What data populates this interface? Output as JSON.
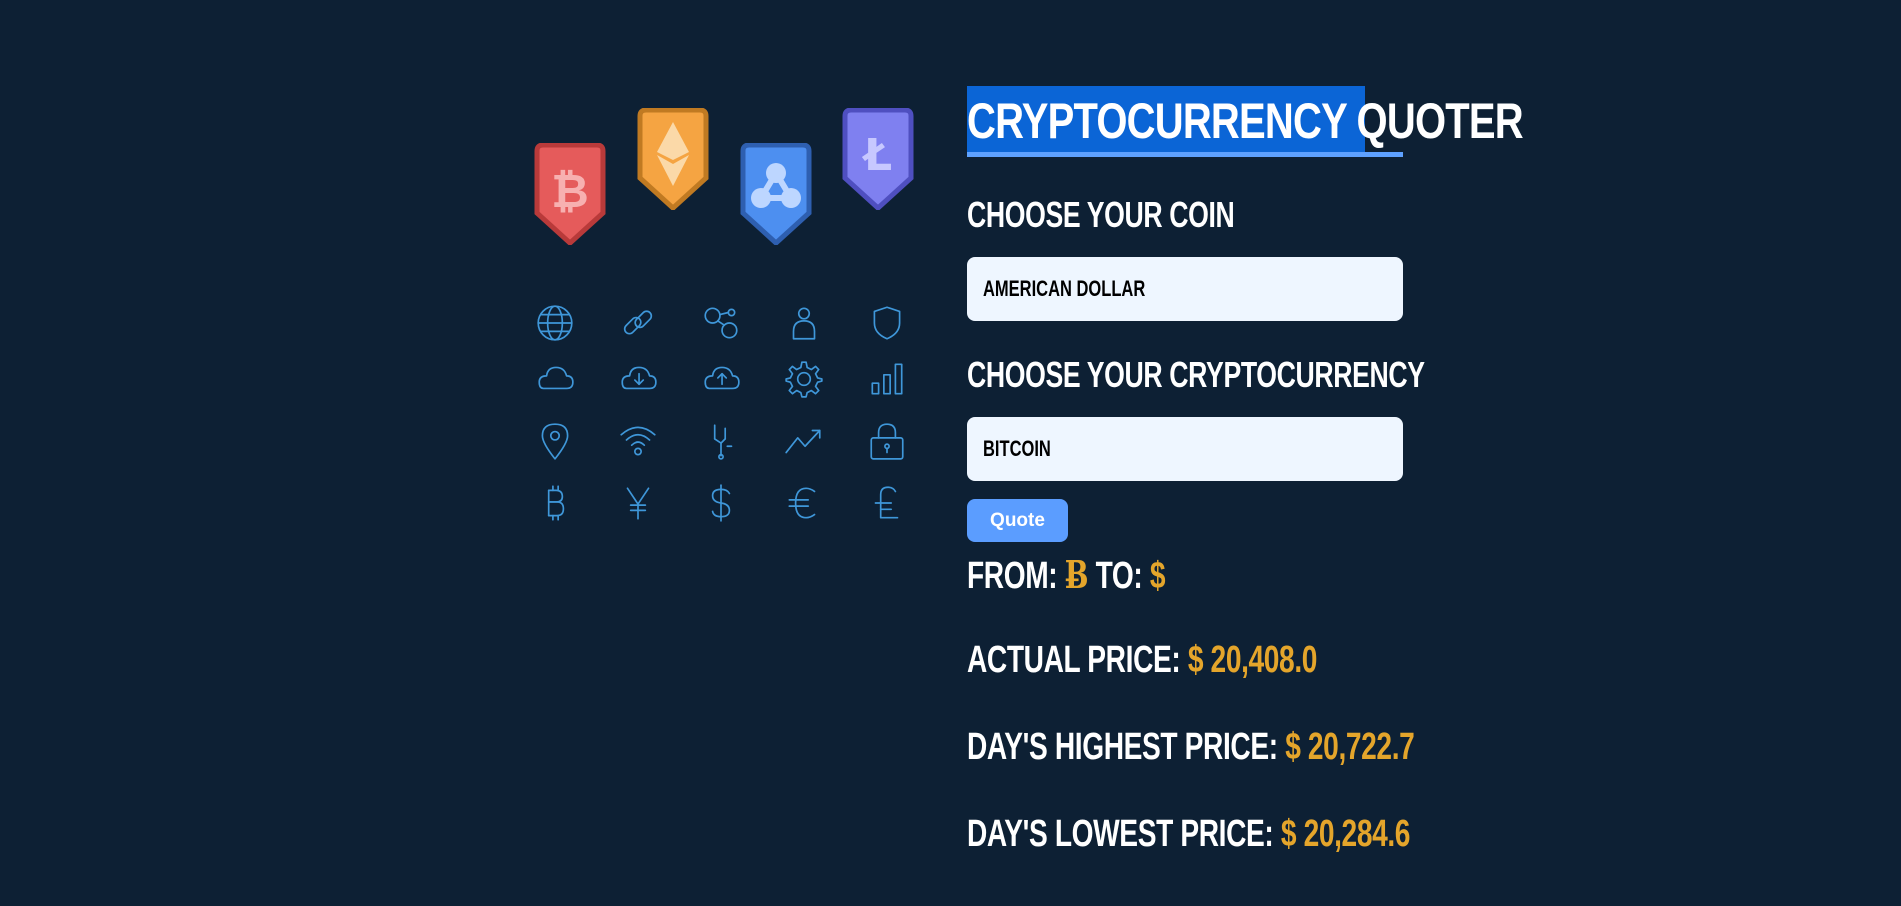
{
  "app": {
    "title": "CRYPTOCURRENCY QUOTER"
  },
  "colors": {
    "background": "#0d2034",
    "title_highlight": "#0b65d6",
    "title_underline": "#5ea1ff",
    "accent_value": "#e4a52b",
    "button": "#5b9dff",
    "select_bg": "#eef6ff",
    "icon_stroke": "#3f97d9",
    "badge_bitcoin": "#e55b5b",
    "badge_ethereum": "#f5a442",
    "badge_ripple": "#4d8ff0",
    "badge_litecoin": "#7f80f0"
  },
  "illustration": {
    "badges": [
      "bitcoin-badge-icon",
      "ethereum-badge-icon",
      "ripple-badge-icon",
      "litecoin-badge-icon"
    ],
    "icons": [
      [
        "globe-icon",
        "link-icon",
        "network-icon",
        "user-icon",
        "shield-icon"
      ],
      [
        "cloud-icon",
        "cloud-download-icon",
        "cloud-upload-icon",
        "gear-icon",
        "bar-chart-icon"
      ],
      [
        "location-pin-icon",
        "wifi-icon",
        "circuit-icon",
        "trend-up-icon",
        "lock-icon"
      ],
      [
        "bitcoin-icon",
        "yen-icon",
        "dollar-icon",
        "euro-icon",
        "pound-icon"
      ]
    ]
  },
  "form": {
    "coin_label": "CHOOSE YOUR COIN",
    "coin_value": "AMERICAN DOLLAR",
    "crypto_label": "CHOOSE YOUR CRYPTOCURRENCY",
    "crypto_value": "BITCOIN",
    "quote_button": "Quote"
  },
  "result": {
    "from_label": "FROM:",
    "from_symbol": "Ƀ",
    "to_label": "TO:",
    "to_symbol": "$",
    "actual_label": "ACTUAL PRICE:",
    "actual_value": "$ 20,408.0",
    "high_label": "DAY'S HIGHEST PRICE:",
    "high_value": "$ 20,722.7",
    "low_label": "DAY'S LOWEST PRICE:",
    "low_value": "$ 20,284.6"
  }
}
